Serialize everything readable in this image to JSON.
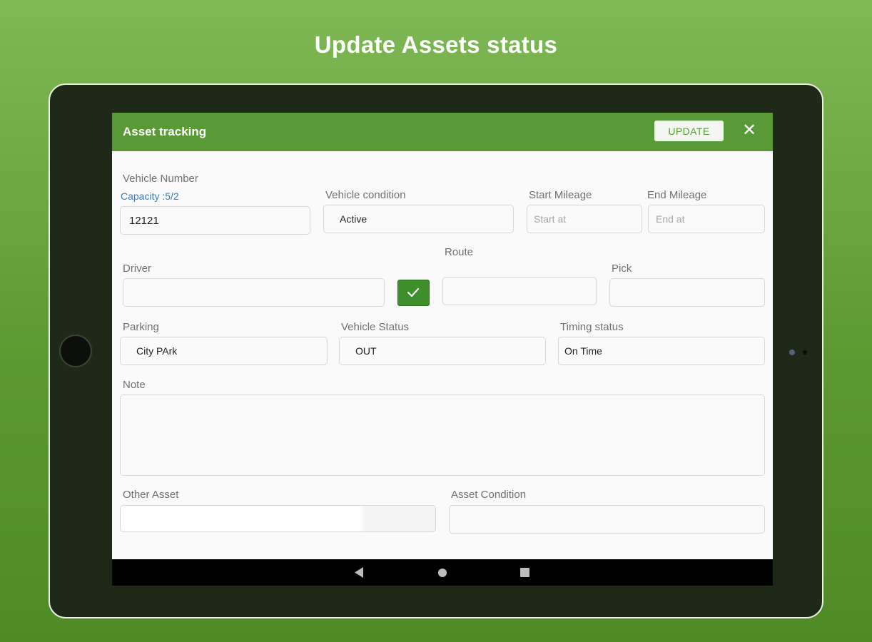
{
  "headline": "Update Assets status",
  "appbar": {
    "title": "Asset tracking",
    "update_label": "UPDATE",
    "close_glyph": "✕"
  },
  "form": {
    "vehicle_number": {
      "label": "Vehicle Number",
      "capacity": "Capacity :5/2",
      "value": "12121"
    },
    "vehicle_condition": {
      "label": "Vehicle condition",
      "value": "Active"
    },
    "start_mileage": {
      "label": "Start Mileage",
      "placeholder": "Start at"
    },
    "end_mileage": {
      "label": "End Mileage",
      "placeholder": "End at"
    },
    "driver": {
      "label": "Driver",
      "value": ""
    },
    "route": {
      "label": "Route",
      "value": ""
    },
    "pick": {
      "label": "Pick",
      "value": ""
    },
    "parking": {
      "label": "Parking",
      "value": "City PArk"
    },
    "vehicle_status": {
      "label": "Vehicle Status",
      "value": "OUT"
    },
    "timing_status": {
      "label": "Timing status",
      "value": "On Time"
    },
    "note": {
      "label": "Note",
      "value": ""
    },
    "other_asset": {
      "label": "Other Asset",
      "value": ""
    },
    "asset_condition": {
      "label": "Asset Condition",
      "value": ""
    }
  },
  "icons": {
    "confirm": "check-icon",
    "close": "close-icon",
    "nav_back": "back-triangle-icon",
    "nav_home": "home-circle-icon",
    "nav_recent": "recent-square-icon"
  },
  "colors": {
    "accent": "#5a9a36",
    "confirm_button": "#3f8e2c",
    "link": "#3a7dc0"
  }
}
